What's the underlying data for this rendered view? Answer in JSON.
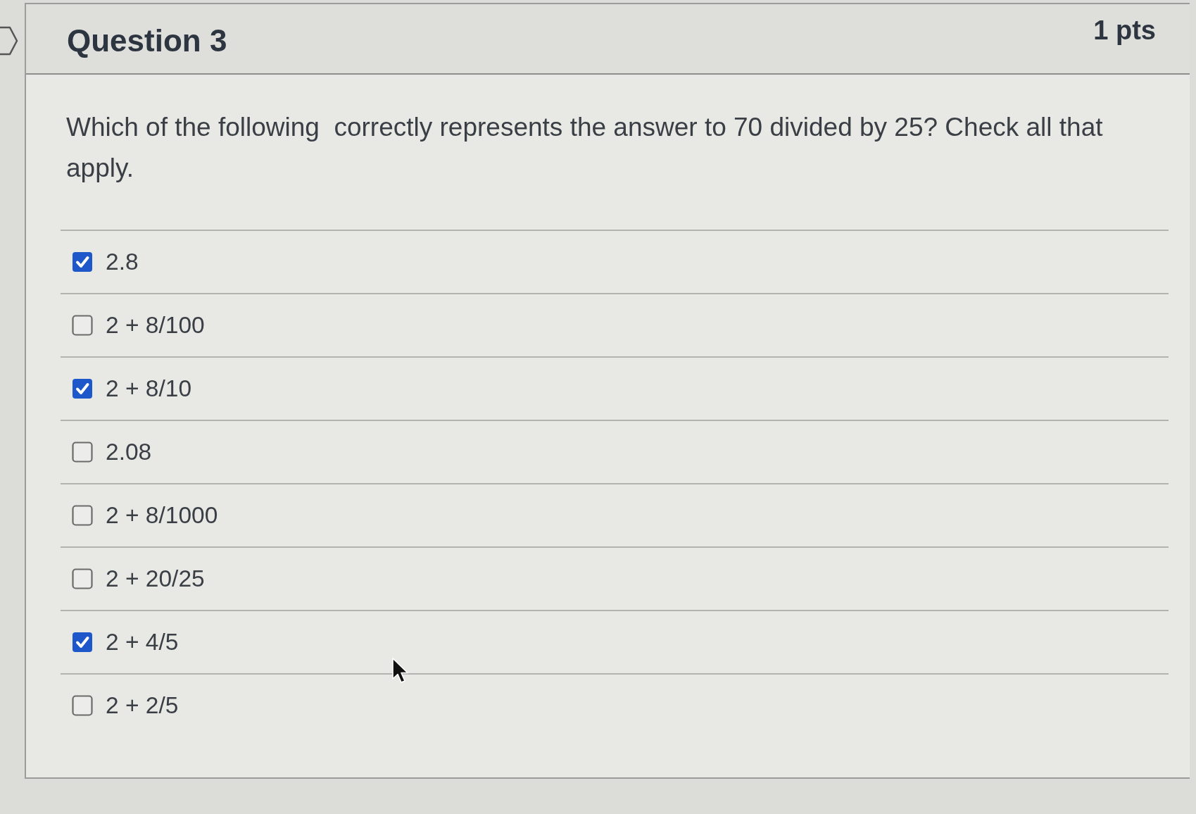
{
  "question": {
    "title": "Question 3",
    "points": "1 pts",
    "text": "Which of the following  correctly represents the answer to 70 divided by 25? Check all that apply."
  },
  "options": [
    {
      "label": "2.8",
      "checked": true
    },
    {
      "label": "2 + 8/100",
      "checked": false
    },
    {
      "label": "2 + 8/10",
      "checked": true
    },
    {
      "label": "2.08",
      "checked": false
    },
    {
      "label": "2 + 8/1000",
      "checked": false
    },
    {
      "label": "2 + 20/25",
      "checked": false
    },
    {
      "label": "2 + 4/5",
      "checked": true
    },
    {
      "label": "2 + 2/5",
      "checked": false
    }
  ]
}
